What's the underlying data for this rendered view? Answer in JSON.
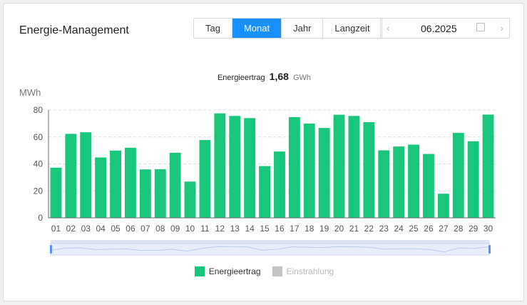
{
  "header": {
    "title": "Energie-Management"
  },
  "periods": [
    {
      "label": "Tag",
      "active": false
    },
    {
      "label": "Monat",
      "active": true
    },
    {
      "label": "Jahr",
      "active": false
    },
    {
      "label": "Langzeit",
      "active": false
    }
  ],
  "date_picker": {
    "value": "06.2025",
    "prev_icon": "chevron-left-icon",
    "next_icon": "chevron-right-icon",
    "calendar_icon": "calendar-icon"
  },
  "summary": {
    "label": "Energieertrag",
    "value": "1,68",
    "unit": "GWh"
  },
  "chart_data": {
    "type": "bar",
    "ylabel": "MWh",
    "ylim": [
      0,
      80
    ],
    "yticks": [
      0,
      20,
      40,
      60,
      80
    ],
    "grid": true,
    "categories": [
      "01",
      "02",
      "03",
      "04",
      "05",
      "06",
      "07",
      "08",
      "09",
      "10",
      "11",
      "12",
      "13",
      "14",
      "15",
      "16",
      "17",
      "18",
      "19",
      "20",
      "21",
      "22",
      "23",
      "24",
      "25",
      "26",
      "27",
      "28",
      "29",
      "30"
    ],
    "series": [
      {
        "name": "Energieertrag",
        "color": "#19c77c",
        "values": [
          37.2,
          62.3,
          63.5,
          44.8,
          49.9,
          52,
          35.9,
          36.1,
          48.3,
          26.9,
          57.7,
          77.5,
          75.6,
          74,
          38.4,
          49.2,
          74.7,
          69.9,
          66.7,
          76.5,
          75.6,
          71,
          50.1,
          52.9,
          54.3,
          47.4,
          17.9,
          63,
          56.8,
          76.6
        ]
      }
    ],
    "legend": [
      {
        "name": "Energieertrag",
        "color": "#19c77c",
        "active": true
      },
      {
        "name": "Einstrahlung",
        "color": "#c4c4c4",
        "active": false
      }
    ],
    "legend_position": "bottom",
    "zoom_slider": {
      "start_percent": 0,
      "end_percent": 100
    }
  }
}
